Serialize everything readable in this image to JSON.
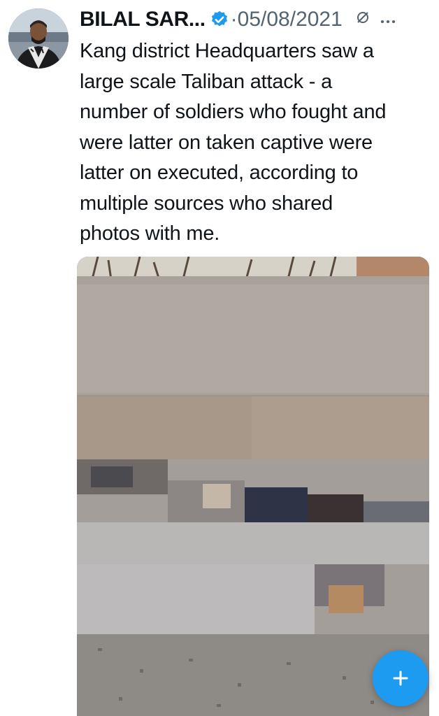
{
  "tweet": {
    "author_name": "BILAL SAR...",
    "separator": "·",
    "date": "05/08/2021",
    "text": "Kang district Headquarters saw a\nlarge scale Taliban attack  - a\nnumber of soldiers who fought and\nwere latter on taken captive were\nlatter on executed, according to\nmultiple sources who shared\nphotos with me."
  },
  "icons": {
    "verified": "verified-badge-icon",
    "mute": "mute-icon",
    "more": "more-options-icon",
    "compose": "plus-icon"
  },
  "colors": {
    "accent": "#1d9bf0",
    "secondary_text": "#536471",
    "primary_text": "#0f1419"
  }
}
